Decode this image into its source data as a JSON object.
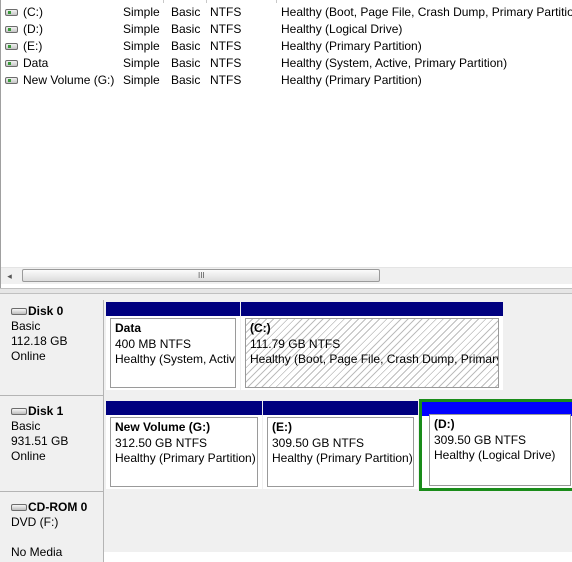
{
  "volumes": [
    {
      "name": "(C:)",
      "layout": "Simple",
      "type": "Basic",
      "fs": "NTFS",
      "status": "Healthy (Boot, Page File, Crash Dump, Primary Partition)"
    },
    {
      "name": "(D:)",
      "layout": "Simple",
      "type": "Basic",
      "fs": "NTFS",
      "status": "Healthy (Logical Drive)"
    },
    {
      "name": "(E:)",
      "layout": "Simple",
      "type": "Basic",
      "fs": "NTFS",
      "status": "Healthy (Primary Partition)"
    },
    {
      "name": "Data",
      "layout": "Simple",
      "type": "Basic",
      "fs": "NTFS",
      "status": "Healthy (System, Active, Primary Partition)"
    },
    {
      "name": "New Volume (G:)",
      "layout": "Simple",
      "type": "Basic",
      "fs": "NTFS",
      "status": "Healthy (Primary Partition)"
    }
  ],
  "scrollbar": {
    "left_arrow": "◂",
    "grip": "III"
  },
  "disks": [
    {
      "title": "Disk 0",
      "kind": "Basic",
      "size": "112.18 GB",
      "state": "Online",
      "partitions": [
        {
          "name": "Data",
          "size": "400 MB NTFS",
          "status": "Healthy (System, Activ"
        },
        {
          "name": "(C:)",
          "size": "111.79 GB NTFS",
          "status": "Healthy (Boot, Page File, Crash Dump, Primary"
        }
      ]
    },
    {
      "title": "Disk 1",
      "kind": "Basic",
      "size": "931.51 GB",
      "state": "Online",
      "partitions": [
        {
          "name": "New Volume  (G:)",
          "size": "312.50 GB NTFS",
          "status": "Healthy (Primary Partition)"
        },
        {
          "name": "(E:)",
          "size": "309.50 GB NTFS",
          "status": "Healthy (Primary Partition)"
        },
        {
          "name": "(D:)",
          "size": "309.50 GB NTFS",
          "status": "Healthy (Logical Drive)"
        }
      ]
    },
    {
      "title": "CD-ROM 0",
      "kind": "DVD (F:)",
      "size": "",
      "state": "No Media"
    }
  ],
  "colors": {
    "partition_bar": "#00007f",
    "selected_bar": "#0000ff",
    "selected_border": "#1a8c1a"
  }
}
